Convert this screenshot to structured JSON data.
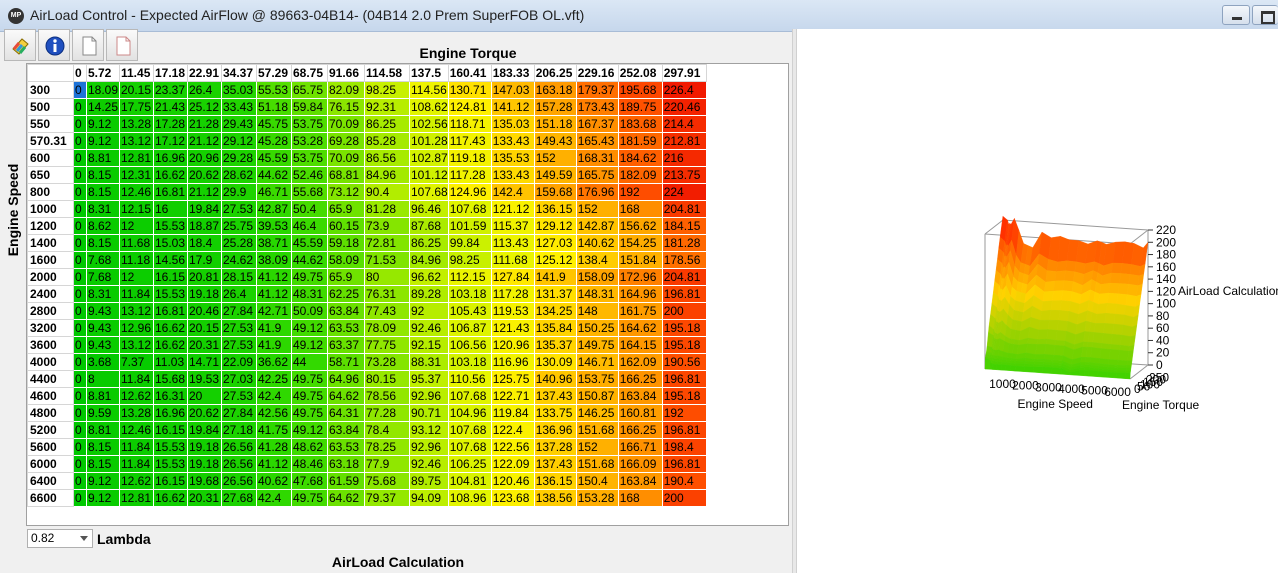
{
  "window": {
    "title": "AirLoad Control - Expected AirFlow @ 89663-04B14- (04B14 2.0 Prem SuperFOB OL.vft)",
    "icon_text": "MP"
  },
  "toolbar": {
    "buttons": [
      {
        "name": "palette-button",
        "icon": "palette-icon"
      },
      {
        "name": "info-button",
        "icon": "info-icon"
      },
      {
        "name": "new-document-button",
        "icon": "document-icon"
      },
      {
        "name": "blank-document-button",
        "icon": "document-icon"
      }
    ]
  },
  "table": {
    "x_title": "Engine Torque",
    "y_title": "Engine Speed",
    "columns": [
      "0",
      "5.72",
      "11.45",
      "17.18",
      "22.91",
      "34.37",
      "57.29",
      "68.75",
      "91.66",
      "114.58",
      "137.5",
      "160.41",
      "183.33",
      "206.25",
      "229.16",
      "252.08",
      "297.91"
    ],
    "rows": [
      {
        "speed": "300",
        "values": [
          "0",
          "18.09",
          "20.15",
          "23.37",
          "26.4",
          "35.03",
          "55.53",
          "65.75",
          "82.09",
          "98.25",
          "114.56",
          "130.71",
          "147.03",
          "163.18",
          "179.37",
          "195.68",
          "226.4"
        ]
      },
      {
        "speed": "500",
        "values": [
          "0",
          "14.25",
          "17.75",
          "21.43",
          "25.12",
          "33.43",
          "51.18",
          "59.84",
          "76.15",
          "92.31",
          "108.62",
          "124.81",
          "141.12",
          "157.28",
          "173.43",
          "189.75",
          "220.46"
        ]
      },
      {
        "speed": "550",
        "values": [
          "0",
          "9.12",
          "13.28",
          "17.28",
          "21.28",
          "29.43",
          "45.75",
          "53.75",
          "70.09",
          "86.25",
          "102.56",
          "118.71",
          "135.03",
          "151.18",
          "167.37",
          "183.68",
          "214.4"
        ]
      },
      {
        "speed": "570.31",
        "values": [
          "0",
          "9.12",
          "13.12",
          "17.12",
          "21.12",
          "29.12",
          "45.28",
          "53.28",
          "69.28",
          "85.28",
          "101.28",
          "117.43",
          "133.43",
          "149.43",
          "165.43",
          "181.59",
          "212.81"
        ]
      },
      {
        "speed": "600",
        "values": [
          "0",
          "8.81",
          "12.81",
          "16.96",
          "20.96",
          "29.28",
          "45.59",
          "53.75",
          "70.09",
          "86.56",
          "102.87",
          "119.18",
          "135.53",
          "152",
          "168.31",
          "184.62",
          "216"
        ]
      },
      {
        "speed": "650",
        "values": [
          "0",
          "8.15",
          "12.31",
          "16.62",
          "20.62",
          "28.62",
          "44.62",
          "52.46",
          "68.81",
          "84.96",
          "101.12",
          "117.28",
          "133.43",
          "149.59",
          "165.75",
          "182.09",
          "213.75"
        ]
      },
      {
        "speed": "800",
        "values": [
          "0",
          "8.15",
          "12.46",
          "16.81",
          "21.12",
          "29.9",
          "46.71",
          "55.68",
          "73.12",
          "90.4",
          "107.68",
          "124.96",
          "142.4",
          "159.68",
          "176.96",
          "192",
          "224"
        ]
      },
      {
        "speed": "1000",
        "values": [
          "0",
          "8.31",
          "12.15",
          "16",
          "19.84",
          "27.53",
          "42.87",
          "50.4",
          "65.9",
          "81.28",
          "96.46",
          "107.68",
          "121.12",
          "136.15",
          "152",
          "168",
          "204.81"
        ]
      },
      {
        "speed": "1200",
        "values": [
          "0",
          "8.62",
          "12",
          "15.53",
          "18.87",
          "25.75",
          "39.53",
          "46.4",
          "60.15",
          "73.9",
          "87.68",
          "101.59",
          "115.37",
          "129.12",
          "142.87",
          "156.62",
          "184.15"
        ]
      },
      {
        "speed": "1400",
        "values": [
          "0",
          "8.15",
          "11.68",
          "15.03",
          "18.4",
          "25.28",
          "38.71",
          "45.59",
          "59.18",
          "72.81",
          "86.25",
          "99.84",
          "113.43",
          "127.03",
          "140.62",
          "154.25",
          "181.28"
        ]
      },
      {
        "speed": "1600",
        "values": [
          "0",
          "7.68",
          "11.18",
          "14.56",
          "17.9",
          "24.62",
          "38.09",
          "44.62",
          "58.09",
          "71.53",
          "84.96",
          "98.25",
          "111.68",
          "125.12",
          "138.4",
          "151.84",
          "178.56"
        ]
      },
      {
        "speed": "2000",
        "values": [
          "0",
          "7.68",
          "12",
          "16.15",
          "20.81",
          "28.15",
          "41.12",
          "49.75",
          "65.9",
          "80",
          "96.62",
          "112.15",
          "127.84",
          "141.9",
          "158.09",
          "172.96",
          "204.81"
        ]
      },
      {
        "speed": "2400",
        "values": [
          "0",
          "8.31",
          "11.84",
          "15.53",
          "19.18",
          "26.4",
          "41.12",
          "48.31",
          "62.25",
          "76.31",
          "89.28",
          "103.18",
          "117.28",
          "131.37",
          "148.31",
          "164.96",
          "196.81"
        ]
      },
      {
        "speed": "2800",
        "values": [
          "0",
          "9.43",
          "13.12",
          "16.81",
          "20.46",
          "27.84",
          "42.71",
          "50.09",
          "63.84",
          "77.43",
          "92",
          "105.43",
          "119.53",
          "134.25",
          "148",
          "161.75",
          "200"
        ]
      },
      {
        "speed": "3200",
        "values": [
          "0",
          "9.43",
          "12.96",
          "16.62",
          "20.15",
          "27.53",
          "41.9",
          "49.12",
          "63.53",
          "78.09",
          "92.46",
          "106.87",
          "121.43",
          "135.84",
          "150.25",
          "164.62",
          "195.18"
        ]
      },
      {
        "speed": "3600",
        "values": [
          "0",
          "9.43",
          "13.12",
          "16.62",
          "20.31",
          "27.53",
          "41.9",
          "49.12",
          "63.37",
          "77.75",
          "92.15",
          "106.56",
          "120.96",
          "135.37",
          "149.75",
          "164.15",
          "195.18"
        ]
      },
      {
        "speed": "4000",
        "values": [
          "0",
          "3.68",
          "7.37",
          "11.03",
          "14.71",
          "22.09",
          "36.62",
          "44",
          "58.71",
          "73.28",
          "88.31",
          "103.18",
          "116.96",
          "130.09",
          "146.71",
          "162.09",
          "190.56"
        ]
      },
      {
        "speed": "4400",
        "values": [
          "0",
          "8",
          "11.84",
          "15.68",
          "19.53",
          "27.03",
          "42.25",
          "49.75",
          "64.96",
          "80.15",
          "95.37",
          "110.56",
          "125.75",
          "140.96",
          "153.75",
          "166.25",
          "196.81"
        ]
      },
      {
        "speed": "4600",
        "values": [
          "0",
          "8.81",
          "12.62",
          "16.31",
          "20",
          "27.53",
          "42.4",
          "49.75",
          "64.62",
          "78.56",
          "92.96",
          "107.68",
          "122.71",
          "137.43",
          "150.87",
          "163.84",
          "195.18"
        ]
      },
      {
        "speed": "4800",
        "values": [
          "0",
          "9.59",
          "13.28",
          "16.96",
          "20.62",
          "27.84",
          "42.56",
          "49.75",
          "64.31",
          "77.28",
          "90.71",
          "104.96",
          "119.84",
          "133.75",
          "146.25",
          "160.81",
          "192"
        ]
      },
      {
        "speed": "5200",
        "values": [
          "0",
          "8.81",
          "12.46",
          "16.15",
          "19.84",
          "27.18",
          "41.75",
          "49.12",
          "63.84",
          "78.4",
          "93.12",
          "107.68",
          "122.4",
          "136.96",
          "151.68",
          "166.25",
          "196.81"
        ]
      },
      {
        "speed": "5600",
        "values": [
          "0",
          "8.15",
          "11.84",
          "15.53",
          "19.18",
          "26.56",
          "41.28",
          "48.62",
          "63.53",
          "78.25",
          "92.96",
          "107.68",
          "122.56",
          "137.28",
          "152",
          "166.71",
          "198.4"
        ]
      },
      {
        "speed": "6000",
        "values": [
          "0",
          "8.15",
          "11.84",
          "15.53",
          "19.18",
          "26.56",
          "41.12",
          "48.46",
          "63.18",
          "77.9",
          "92.46",
          "106.25",
          "122.09",
          "137.43",
          "151.68",
          "166.09",
          "196.81"
        ]
      },
      {
        "speed": "6400",
        "values": [
          "0",
          "9.12",
          "12.62",
          "16.15",
          "19.68",
          "26.56",
          "40.62",
          "47.68",
          "61.59",
          "75.68",
          "89.75",
          "104.81",
          "120.46",
          "136.15",
          "150.4",
          "163.84",
          "190.4"
        ]
      },
      {
        "speed": "6600",
        "values": [
          "0",
          "9.12",
          "12.81",
          "16.62",
          "20.31",
          "27.68",
          "42.4",
          "49.75",
          "64.62",
          "79.37",
          "94.09",
          "108.96",
          "123.68",
          "138.56",
          "153.28",
          "168",
          "200"
        ]
      }
    ]
  },
  "lambda": {
    "value": "0.82",
    "label": "Lambda"
  },
  "bottom_title": "AirLoad Calculation",
  "chart_data": {
    "type": "surface",
    "z_axis_label": "AirLoad Calculation",
    "z_ticks": [
      "220",
      "200",
      "180",
      "160",
      "140",
      "120",
      "100",
      "80",
      "60",
      "40",
      "20",
      "0"
    ],
    "x_axis_label": "Engine Speed",
    "x_ticks": [
      "1000",
      "2000",
      "3000",
      "4000",
      "5000",
      "6000"
    ],
    "y_axis_label": "Engine Torque",
    "y_ticks": [
      "0",
      "50",
      "100",
      "150",
      "200",
      "250"
    ],
    "zlim": [
      0,
      220
    ]
  },
  "colors": {
    "low": "#00cc00",
    "mid": "#ffff00",
    "high": "#ff0000",
    "selected": "#1e73d8"
  }
}
